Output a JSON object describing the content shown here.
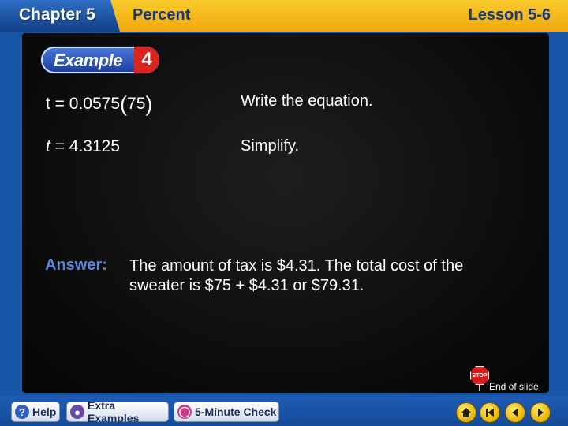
{
  "header": {
    "chapter": "Chapter 5",
    "topic": "Percent",
    "lesson": "Lesson 5-6"
  },
  "example": {
    "word": "Example",
    "number": "4"
  },
  "steps": [
    {
      "eq_var": "t",
      "eq_mid": " = 0.0575",
      "eq_arg": "75",
      "description": "Write the equation."
    },
    {
      "eq_var": "t",
      "eq_rest": " = 4.3125",
      "description": "Simplify."
    }
  ],
  "answer": {
    "label": "Answer:",
    "text": "The amount of tax is $4.31. The total cost of the sweater is $75 + $4.31 or $79.31."
  },
  "end_of_slide": {
    "stop_text": "STOP",
    "label": "End of slide"
  },
  "toolbar": {
    "help_label": "Help",
    "extra_label": "Extra Examples",
    "check_label": "5-Minute Check"
  },
  "colors": {
    "header_yellow": "#f4b81e",
    "chapter_blue": "#1f55a8",
    "answer_blue": "#5e86dc",
    "stop_red": "#d41d1d",
    "nav_gold": "#e6b400"
  }
}
